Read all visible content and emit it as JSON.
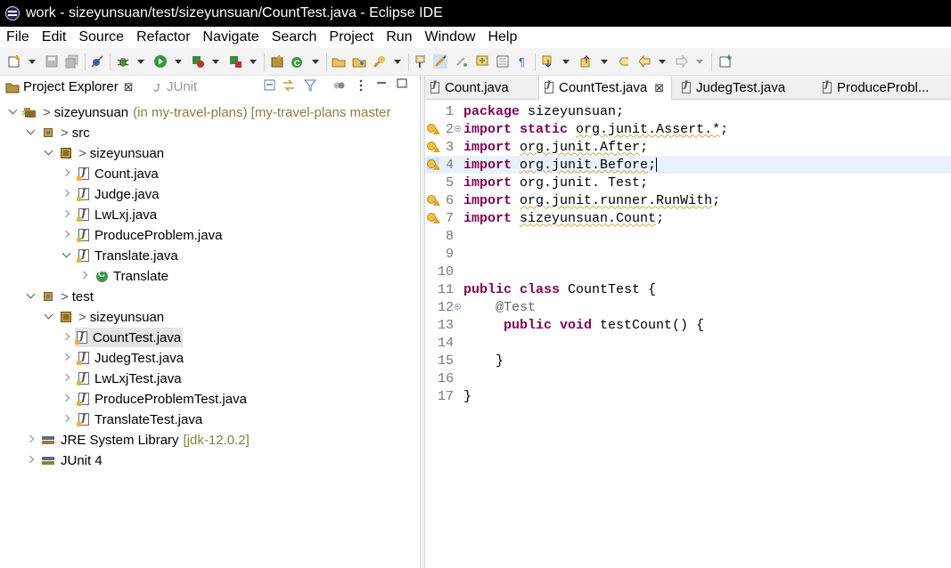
{
  "window": {
    "title": "work - sizeyunsuan/test/sizeyunsuan/CountTest.java - Eclipse IDE"
  },
  "menu": [
    "File",
    "Edit",
    "Source",
    "Refactor",
    "Navigate",
    "Search",
    "Project",
    "Run",
    "Window",
    "Help"
  ],
  "left_panel": {
    "tabs": [
      {
        "label": "Project Explorer",
        "close": "⊠"
      },
      {
        "label": "JUnit"
      }
    ],
    "tree": [
      {
        "label": "sizeyunsuan",
        "prefix": ">",
        "decoration": "(in my-travel-plans) [my-travel-plans master",
        "icon": "project-icon"
      },
      {
        "label": "src",
        "prefix": ">",
        "icon": "source-folder-icon"
      },
      {
        "label": "sizeyunsuan",
        "prefix": ">",
        "icon": "package-icon"
      },
      {
        "label": "Count.java",
        "icon": "java-file-icon"
      },
      {
        "label": "Judge.java",
        "icon": "java-file-icon"
      },
      {
        "label": "LwLxj.java",
        "icon": "java-file-icon"
      },
      {
        "label": "ProduceProblem.java",
        "icon": "java-file-icon"
      },
      {
        "label": "Translate.java",
        "icon": "java-file-icon"
      },
      {
        "label": "Translate",
        "icon": "class-icon"
      },
      {
        "label": "test",
        "prefix": ">",
        "icon": "source-folder-icon"
      },
      {
        "label": "sizeyunsuan",
        "prefix": ">",
        "icon": "package-icon"
      },
      {
        "label": "CountTest.java",
        "icon": "java-file-icon",
        "selected": true
      },
      {
        "label": "JudegTest.java",
        "icon": "java-file-icon"
      },
      {
        "label": "LwLxjTest.java",
        "icon": "java-file-icon"
      },
      {
        "label": "ProduceProblemTest.java",
        "icon": "java-file-icon"
      },
      {
        "label": "TranslateTest.java",
        "icon": "java-file-icon"
      },
      {
        "label": "JRE System Library",
        "decoration": "[jdk-12.0.2]",
        "icon": "library-icon"
      },
      {
        "label": "JUnit 4",
        "icon": "library-icon"
      }
    ]
  },
  "editor": {
    "tabs": [
      {
        "label": "Count.java"
      },
      {
        "label": "CountTest.java",
        "active": true,
        "close": "⊠"
      },
      {
        "label": "JudegTest.java"
      },
      {
        "label": "ProduceProbl..."
      }
    ],
    "line_numbers": [
      "1",
      "2",
      "3",
      "4",
      "5",
      "6",
      "7",
      "8",
      "9",
      "10",
      "11",
      "12",
      "13",
      "14",
      "15",
      "16",
      "17"
    ],
    "lines": [
      {
        "kw": "package",
        "rest": " sizeyunsuan;"
      },
      {
        "kw": "import static",
        "rest": " ",
        "warn": "org.junit.Assert.*",
        "tail": ";"
      },
      {
        "kw": "import",
        "rest": " ",
        "warn": "org.junit.After",
        "tail": ";"
      },
      {
        "kw": "import",
        "rest": " ",
        "warn": "org.junit.Before",
        "tail": ";"
      },
      {
        "kw": "import",
        "rest": " ",
        "warn": "org.junit. Test",
        "tail": ";"
      },
      {
        "kw": "import",
        "rest": " ",
        "warn": "org.junit.runner.RunWith",
        "tail": ";"
      },
      {
        "kw": "import",
        "rest": " ",
        "warn": "sizeyunsuan.Count",
        "tail": ";"
      },
      {
        "kw": "",
        "rest": ""
      },
      {
        "kw": "",
        "rest": ""
      },
      {
        "kw": "",
        "rest": ""
      },
      {
        "kw": "public class",
        "rest": " CountTest {"
      },
      {
        "kw": "",
        "ann": "    @Test",
        "rest": ""
      },
      {
        "kw": "     public void",
        "rest": " testCount() {"
      },
      {
        "kw": "",
        "rest": ""
      },
      {
        "kw": "",
        "rest": "    }"
      },
      {
        "kw": "",
        "rest": ""
      },
      {
        "kw": "",
        "rest": "}"
      }
    ]
  }
}
